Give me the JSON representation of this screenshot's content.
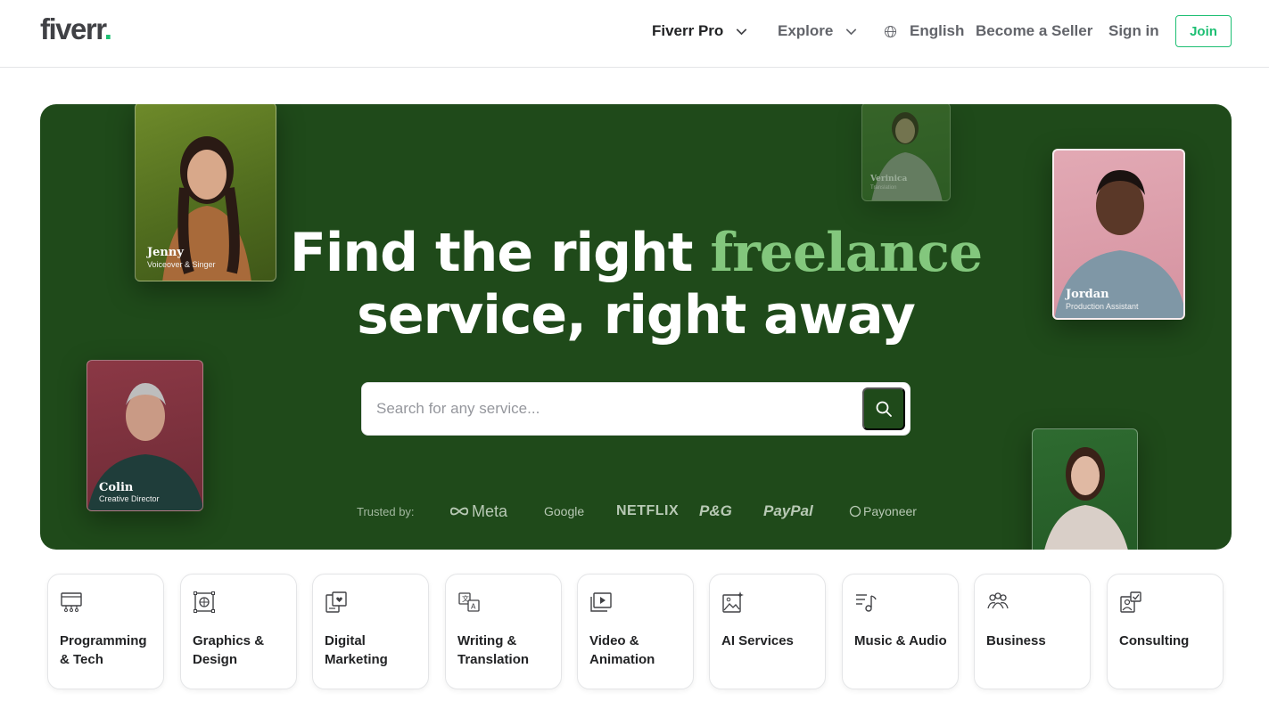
{
  "header": {
    "logo_text": "fiverr",
    "logo_dot": ".",
    "nav": {
      "fiverr_pro": "Fiverr Pro",
      "explore": "Explore",
      "language": "English",
      "become_seller": "Become a Seller",
      "sign_in": "Sign in",
      "join": "Join"
    }
  },
  "hero": {
    "title_line1_prefix": "Find the right",
    "title_line1_accent": "freelance",
    "title_line2": "service, right away",
    "search_placeholder": "Search for any service...",
    "trusted_label": "Trusted by:",
    "trusted_logos": [
      "Meta",
      "Google",
      "NETFLIX",
      "P&G",
      "PayPal",
      "Payoneer"
    ],
    "freelancers": [
      {
        "name": "Jenny",
        "role": "Voiceover & Singer"
      },
      {
        "name": "Colin",
        "role": "Creative Director"
      },
      {
        "name": "Verinica",
        "role": "Translation"
      },
      {
        "name": "Jordan",
        "role": "Production Assistant"
      }
    ]
  },
  "categories": [
    {
      "label": "Programming & Tech",
      "icon": "monitor-icon"
    },
    {
      "label": "Graphics & Design",
      "icon": "design-frame-icon"
    },
    {
      "label": "Digital Marketing",
      "icon": "marketing-device-icon"
    },
    {
      "label": "Writing & Translation",
      "icon": "translation-icon"
    },
    {
      "label": "Video & Animation",
      "icon": "video-play-icon"
    },
    {
      "label": "AI Services",
      "icon": "ai-image-icon"
    },
    {
      "label": "Music & Audio",
      "icon": "music-note-icon"
    },
    {
      "label": "Business",
      "icon": "people-icon"
    },
    {
      "label": "Consulting",
      "icon": "consulting-check-icon"
    }
  ],
  "colors": {
    "brand_green": "#1dbf73",
    "hero_bg": "#1f4a1a",
    "accent_text": "#83c77d"
  }
}
